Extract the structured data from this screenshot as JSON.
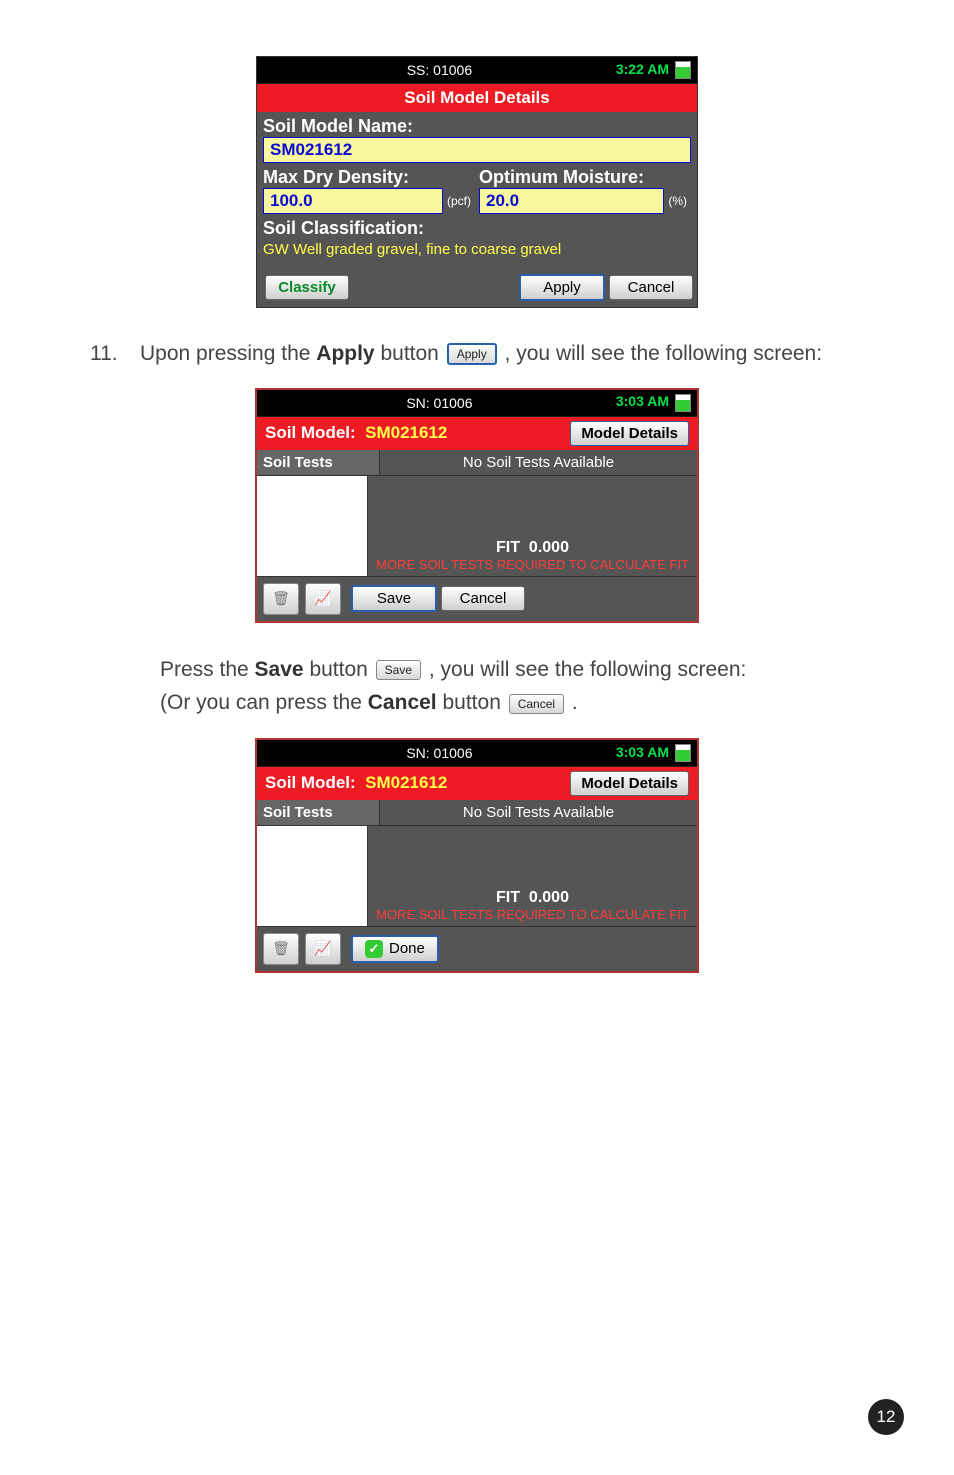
{
  "step": {
    "num": "11.",
    "pre": "Upon pressing the ",
    "btn_name": "Apply",
    "post_btn": " button ",
    "inline_btn": "Apply",
    "post": ", you will see the following screen:"
  },
  "para2": {
    "pre": "Press the ",
    "btn_name": "Save",
    "mid1": " button ",
    "inline_save": "Save",
    "mid2": ", you will see the following screen:",
    "line2_pre": "(Or you can press the ",
    "cancel_name": "Cancel",
    "line2_mid": " button ",
    "inline_cancel": "Cancel",
    "line2_post": "."
  },
  "screen1": {
    "status_center": "SS: 01006",
    "status_time": "3:22 AM",
    "title": "Soil Model Details",
    "name_label": "Soil Model Name:",
    "name_value": "SM021612",
    "density_label": "Max Dry Density:",
    "density_value": "100.0",
    "density_unit": "(pcf)",
    "moisture_label": "Optimum Moisture:",
    "moisture_value": "20.0",
    "moisture_unit": "(%)",
    "class_label": "Soil Classification:",
    "class_value": "GW Well graded gravel, fine to coarse gravel",
    "classify_btn": "Classify",
    "apply_btn": "Apply",
    "cancel_btn": "Cancel"
  },
  "screen2": {
    "status_center": "SN: 01006",
    "status_time": "3:03 AM",
    "model_prefix": "Soil Model:",
    "model_value": "SM021612",
    "model_details": "Model Details",
    "tests_label": "Soil Tests",
    "tests_msg": "No Soil Tests Available",
    "fit_label": "FIT",
    "fit_value": "0.000",
    "warn": "MORE SOIL TESTS REQUIRED TO CALCULATE FIT",
    "save_btn": "Save",
    "cancel_btn": "Cancel"
  },
  "screen3": {
    "status_center": "SN: 01006",
    "status_time": "3:03 AM",
    "model_prefix": "Soil Model:",
    "model_value": "SM021612",
    "model_details": "Model Details",
    "tests_label": "Soil Tests",
    "tests_msg": "No Soil Tests Available",
    "fit_label": "FIT",
    "fit_value": "0.000",
    "warn": "MORE SOIL TESTS REQUIRED TO CALCULATE FIT",
    "done_btn": "Done"
  },
  "icons": {
    "trash": "🗑",
    "graph": "📈",
    "check": "✓"
  },
  "page_number": "12"
}
